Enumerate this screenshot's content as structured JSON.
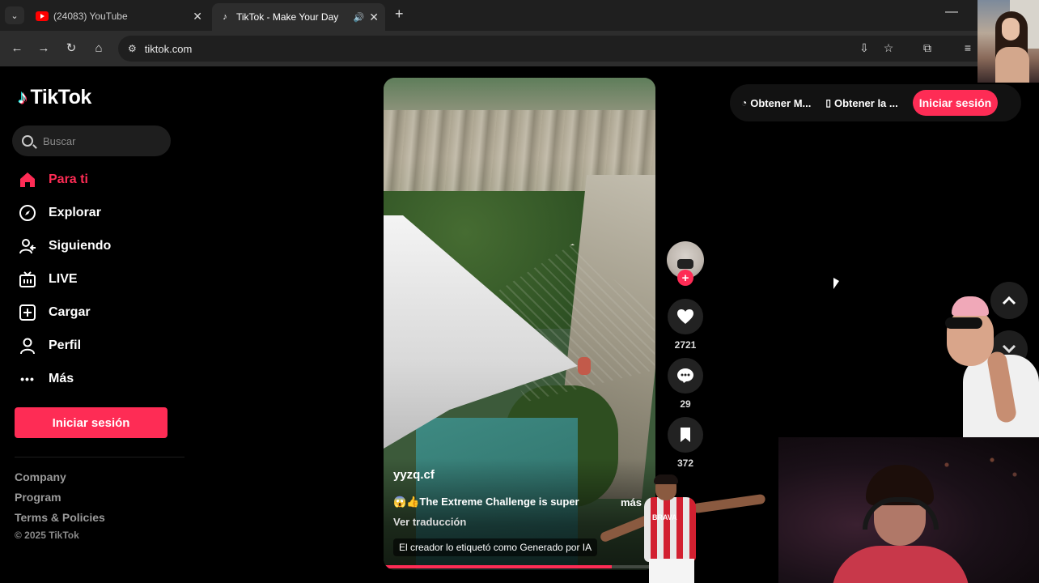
{
  "browser": {
    "tabs": [
      {
        "title": "(24083) YouTube",
        "favicon": "youtube-icon"
      },
      {
        "title": "TikTok - Make Your Day",
        "favicon": "tiktok-icon",
        "active": true,
        "audio": true
      }
    ],
    "url": "tiktok.com"
  },
  "sidebar": {
    "logo": "TikTok",
    "search_placeholder": "Buscar",
    "nav": [
      {
        "label": "Para ti",
        "icon": "home-icon",
        "active": true
      },
      {
        "label": "Explorar",
        "icon": "compass-icon"
      },
      {
        "label": "Siguiendo",
        "icon": "following-icon"
      },
      {
        "label": "LIVE",
        "icon": "live-tv-icon"
      },
      {
        "label": "Cargar",
        "icon": "upload-icon"
      },
      {
        "label": "Perfil",
        "icon": "profile-icon"
      },
      {
        "label": "Más",
        "icon": "more-dots-icon"
      }
    ],
    "login_label": "Iniciar sesión",
    "footer_links": [
      "Company",
      "Program",
      "Terms & Policies"
    ],
    "copyright": "© 2025 TikTok"
  },
  "video": {
    "username": "yyzq.cf",
    "description": "😱👍The Extreme Challenge is super",
    "more_label": "más",
    "translate_label": "Ver traducción",
    "ai_label": "El creador lo etiquetó como Generado por IA",
    "progress": 0.84
  },
  "actions": {
    "likes": "2721",
    "comments": "29",
    "saves": "372"
  },
  "topbar": {
    "link1": "Obtener M...",
    "link2": "Obtener la ...",
    "login": "Iniciar sesión"
  },
  "overlays": {
    "player_jersey": "BRAVA"
  },
  "colors": {
    "accent": "#fe2c55",
    "background": "#000000"
  }
}
